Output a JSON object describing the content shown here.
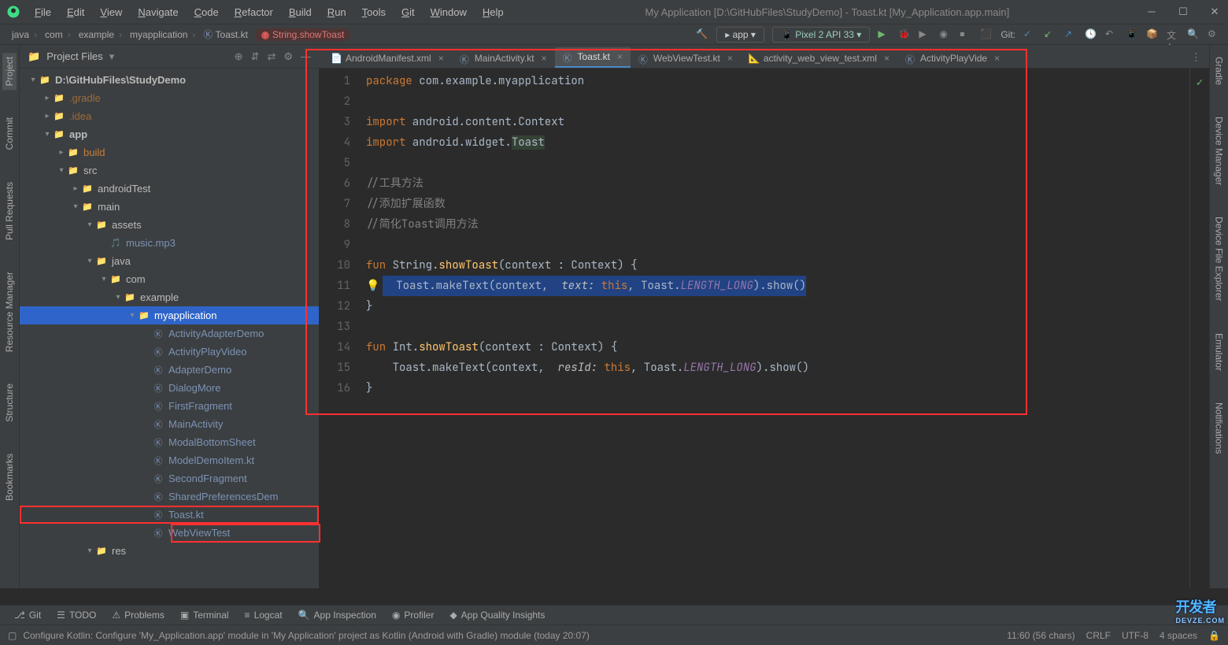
{
  "title": "My Application [D:\\GitHubFiles\\StudyDemo] - Toast.kt [My_Application.app.main]",
  "menu": [
    "File",
    "Edit",
    "View",
    "Navigate",
    "Code",
    "Refactor",
    "Build",
    "Run",
    "Tools",
    "Git",
    "Window",
    "Help"
  ],
  "breadcrumbs": [
    "java",
    "com",
    "example",
    "myapplication",
    "Toast.kt"
  ],
  "fn_crumb": "String.showToast",
  "run_config": "app ▾",
  "device": "Pixel 2 API 33 ▾",
  "git_label": "Git:",
  "left_tabs": [
    "Project",
    "Commit",
    "Pull Requests",
    "Resource Manager",
    "Structure",
    "Bookmarks"
  ],
  "right_tabs": [
    "Gradle",
    "Device Manager",
    "Device File Explorer",
    "Emulator",
    "Notifications"
  ],
  "sidehead": "Project Files",
  "tree": [
    {
      "d": 0,
      "a": "▾",
      "i": "📁",
      "t": "D:\\GitHubFiles\\StudyDemo",
      "b": true
    },
    {
      "d": 1,
      "a": "▸",
      "i": "📁",
      "t": ".gradle",
      "c": "#9c6b3a"
    },
    {
      "d": 1,
      "a": "▸",
      "i": "📁",
      "t": ".idea",
      "c": "#9c6b3a"
    },
    {
      "d": 1,
      "a": "▾",
      "i": "📁",
      "t": "app",
      "b": true
    },
    {
      "d": 2,
      "a": "▸",
      "i": "📁",
      "t": "build",
      "c": "#c57e3a"
    },
    {
      "d": 2,
      "a": "▾",
      "i": "📁",
      "t": "src"
    },
    {
      "d": 3,
      "a": "▸",
      "i": "📁",
      "t": "androidTest"
    },
    {
      "d": 3,
      "a": "▾",
      "i": "📁",
      "t": "main"
    },
    {
      "d": 4,
      "a": "▾",
      "i": "📁",
      "t": "assets"
    },
    {
      "d": 5,
      "a": "",
      "i": "🎵",
      "t": "music.mp3",
      "c": "#7b92b5"
    },
    {
      "d": 4,
      "a": "▾",
      "i": "📁",
      "t": "java"
    },
    {
      "d": 5,
      "a": "▾",
      "i": "📁",
      "t": "com"
    },
    {
      "d": 6,
      "a": "▾",
      "i": "📁",
      "t": "example"
    },
    {
      "d": 7,
      "a": "▾",
      "i": "📁",
      "t": "myapplication",
      "sel": true
    },
    {
      "d": 8,
      "a": "",
      "i": "Ⓚ",
      "t": "ActivityAdapterDemo",
      "c": "#7b92b5"
    },
    {
      "d": 8,
      "a": "",
      "i": "Ⓚ",
      "t": "ActivityPlayVideo",
      "c": "#7b92b5"
    },
    {
      "d": 8,
      "a": "",
      "i": "Ⓚ",
      "t": "AdapterDemo",
      "c": "#7b92b5"
    },
    {
      "d": 8,
      "a": "",
      "i": "Ⓚ",
      "t": "DialogMore",
      "c": "#7b92b5"
    },
    {
      "d": 8,
      "a": "",
      "i": "Ⓚ",
      "t": "FirstFragment",
      "c": "#7b92b5"
    },
    {
      "d": 8,
      "a": "",
      "i": "Ⓚ",
      "t": "MainActivity",
      "c": "#7b92b5"
    },
    {
      "d": 8,
      "a": "",
      "i": "Ⓚ",
      "t": "ModalBottomSheet",
      "c": "#7b92b5"
    },
    {
      "d": 8,
      "a": "",
      "i": "Ⓚ",
      "t": "ModelDemoItem.kt",
      "c": "#7b92b5"
    },
    {
      "d": 8,
      "a": "",
      "i": "Ⓚ",
      "t": "SecondFragment",
      "c": "#7b92b5"
    },
    {
      "d": 8,
      "a": "",
      "i": "Ⓚ",
      "t": "SharedPreferencesDem",
      "c": "#7b92b5"
    },
    {
      "d": 8,
      "a": "",
      "i": "Ⓚ",
      "t": "Toast.kt",
      "c": "#7b92b5",
      "hl": true
    },
    {
      "d": 8,
      "a": "",
      "i": "Ⓚ",
      "t": "WebViewTest",
      "c": "#7b92b5"
    },
    {
      "d": 4,
      "a": "▾",
      "i": "📁",
      "t": "res"
    }
  ],
  "tabs": [
    {
      "l": "AndroidManifest.xml",
      "ic": "📄"
    },
    {
      "l": "MainActivity.kt",
      "ic": "Ⓚ"
    },
    {
      "l": "Toast.kt",
      "ic": "Ⓚ",
      "act": true
    },
    {
      "l": "WebViewTest.kt",
      "ic": "Ⓚ"
    },
    {
      "l": "activity_web_view_test.xml",
      "ic": "📐"
    },
    {
      "l": "ActivityPlayVide",
      "ic": "Ⓚ"
    }
  ],
  "lines": [
    "1",
    "2",
    "3",
    "4",
    "5",
    "6",
    "7",
    "8",
    "9",
    "10",
    "11",
    "12",
    "13",
    "14",
    "15",
    "16"
  ],
  "code": {
    "l1_kw": "package",
    "l1_id": " com.example.myapplication",
    "l3_kw": "import",
    "l3_id": " android.content.Context",
    "l4_kw": "import",
    "l4_id": " android.widget.",
    "l4_t": "Toast",
    "c1": "//工具方法",
    "c2": "//添加扩展函数",
    "c3": "//简化Toast调用方法",
    "f1a": "fun ",
    "f1b": "String.",
    "f1c": "showToast",
    "f1d": "(context : Context) {",
    "l11a": "Toast.makeText(context, ",
    "l11p": "text:",
    "l11b": " this",
    "l11c": ", Toast.",
    "l11d": "LENGTH_LONG",
    "l11e": ").show()",
    "br": "}",
    "f2a": "fun ",
    "f2b": "Int.",
    "f2c": "showToast",
    "f2d": "(context : Context) {",
    "l15a": "Toast.makeText(context, ",
    "l15p": "resId:",
    "l15b": " this",
    "l15c": ", Toast.",
    "l15d": "LENGTH_LONG",
    "l15e": ").show()"
  },
  "bottom_tabs": [
    "Git",
    "TODO",
    "Problems",
    "Terminal",
    "Logcat",
    "App Inspection",
    "Profiler",
    "App Quality Insights"
  ],
  "status_msg": "Configure Kotlin: Configure 'My_Application.app' module in 'My Application' project as Kotlin (Android with Gradle) module (today 20:07)",
  "status_right": [
    "11:60 (56 chars)",
    "CRLF",
    "UTF-8",
    "4 spaces"
  ],
  "corner_logo": "开发者\nDEVZE.COM"
}
